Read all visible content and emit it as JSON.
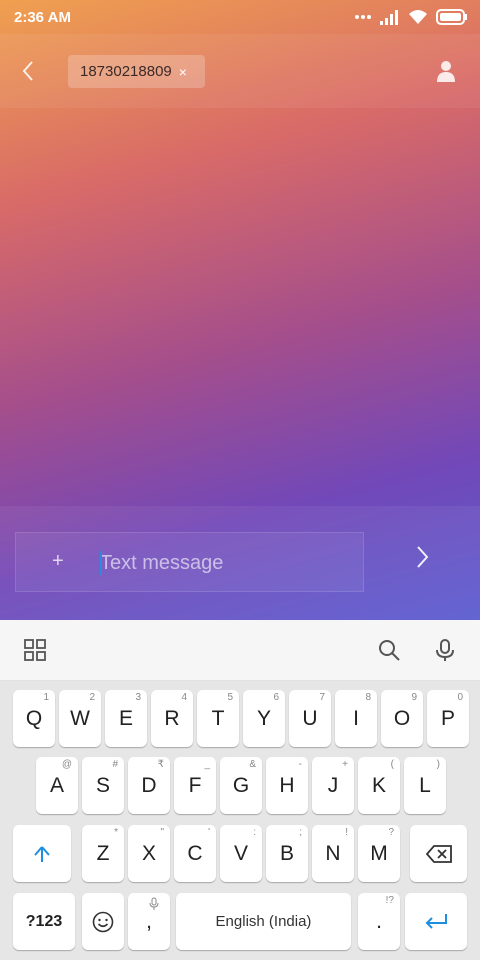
{
  "status_bar": {
    "time": "2:36 AM",
    "icons": [
      "more-dots-icon",
      "signal-icon",
      "wifi-icon",
      "battery-icon"
    ]
  },
  "header": {
    "back_icon": "chevron-left-icon",
    "recipient": "18730218809",
    "remove_icon": "×",
    "contact_icon": "person-icon"
  },
  "composer": {
    "plus": "+",
    "placeholder": "Text message",
    "value": "",
    "send_icon": "chevron-right-icon"
  },
  "keyboard_toolbar": {
    "icons": [
      "grid-icon",
      "search-icon",
      "microphone-icon"
    ]
  },
  "keyboard": {
    "row1": [
      {
        "label": "Q",
        "hint": "1"
      },
      {
        "label": "W",
        "hint": "2"
      },
      {
        "label": "E",
        "hint": "3"
      },
      {
        "label": "R",
        "hint": "4"
      },
      {
        "label": "T",
        "hint": "5"
      },
      {
        "label": "Y",
        "hint": "6"
      },
      {
        "label": "U",
        "hint": "7"
      },
      {
        "label": "I",
        "hint": "8"
      },
      {
        "label": "O",
        "hint": "9"
      },
      {
        "label": "P",
        "hint": "0"
      }
    ],
    "row2": [
      {
        "label": "A",
        "hint": "@"
      },
      {
        "label": "S",
        "hint": "#"
      },
      {
        "label": "D",
        "hint": "₹"
      },
      {
        "label": "F",
        "hint": "_"
      },
      {
        "label": "G",
        "hint": "&"
      },
      {
        "label": "H",
        "hint": "-"
      },
      {
        "label": "J",
        "hint": "+"
      },
      {
        "label": "K",
        "hint": "("
      },
      {
        "label": "L",
        "hint": ")"
      }
    ],
    "row3": [
      {
        "label": "Z",
        "hint": "*"
      },
      {
        "label": "X",
        "hint": "\""
      },
      {
        "label": "C",
        "hint": "'"
      },
      {
        "label": "V",
        "hint": ":"
      },
      {
        "label": "B",
        "hint": ";"
      },
      {
        "label": "N",
        "hint": "!"
      },
      {
        "label": "M",
        "hint": "?"
      }
    ],
    "shift_icon": "shift-arrow-icon",
    "backspace_icon": "backspace-icon",
    "symbols_label": "?123",
    "emoji_icon": "smiley-icon",
    "comma": ",",
    "comma_hint": "mic",
    "space_label": "English (India)",
    "period": ".",
    "period_hint": "!?",
    "enter_icon": "enter-arrow-icon"
  }
}
